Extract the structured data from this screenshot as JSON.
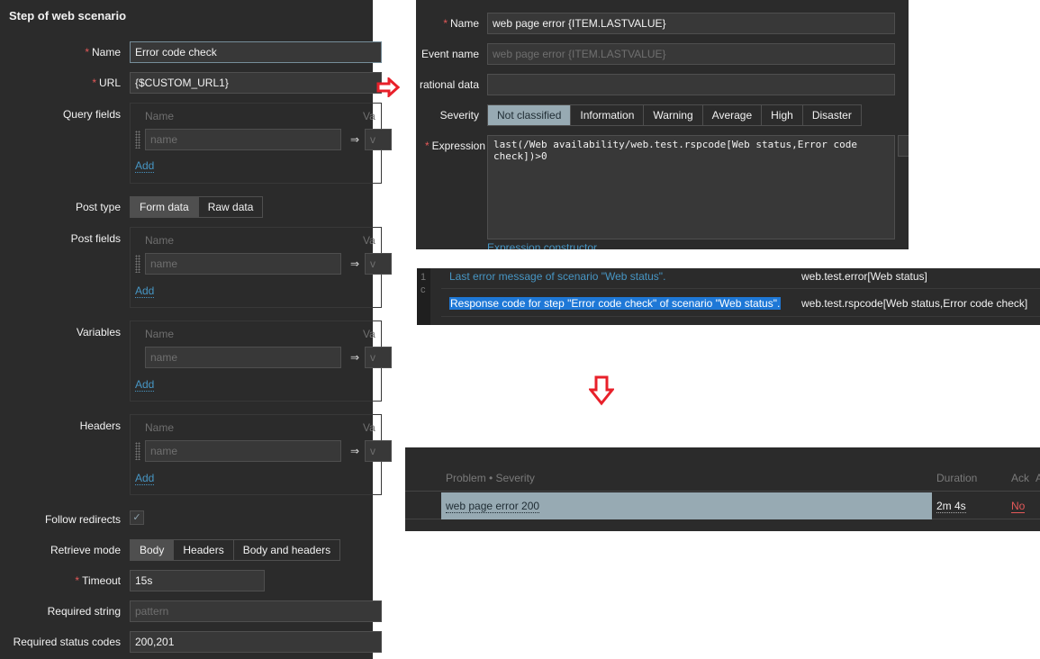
{
  "step_form": {
    "title": "Step of web scenario",
    "name_label": "Name",
    "name_value": "Error code check",
    "url_label": "URL",
    "url_value": "{$CUSTOM_URL1}",
    "query_fields_label": "Query fields",
    "post_type_label": "Post type",
    "post_type_options": [
      "Form data",
      "Raw data"
    ],
    "post_fields_label": "Post fields",
    "variables_label": "Variables",
    "headers_label": "Headers",
    "col_name": "Name",
    "col_value": "Va",
    "name_placeholder": "name",
    "value_placeholder": "v",
    "add_label": "Add",
    "arrow": "⇒",
    "follow_redirects_label": "Follow redirects",
    "follow_redirects_checked": true,
    "retrieve_mode_label": "Retrieve mode",
    "retrieve_mode_options": [
      "Body",
      "Headers",
      "Body and headers"
    ],
    "timeout_label": "Timeout",
    "timeout_value": "15s",
    "required_string_label": "Required string",
    "required_string_placeholder": "pattern",
    "required_status_codes_label": "Required status codes",
    "required_status_codes_value": "200,201"
  },
  "trigger_form": {
    "name_label": "Name",
    "name_value": "web page error {ITEM.LASTVALUE}",
    "event_name_label": "Event name",
    "event_name_placeholder": "web page error {ITEM.LASTVALUE}",
    "operational_data_label": "rational data",
    "severity_label": "Severity",
    "severities": [
      "Not classified",
      "Information",
      "Warning",
      "Average",
      "High",
      "Disaster"
    ],
    "expression_label": "Expression",
    "expression_value": "last(/Web availability/web.test.rspcode[Web status,Error code check])>0",
    "expression_constructor": "Expression constructor"
  },
  "item_list": {
    "gutter": [
      "1",
      "c"
    ],
    "rows": [
      {
        "description": "Last error message of scenario \"Web status\".",
        "key": "web.test.error[Web status]"
      },
      {
        "description": "Response code for step \"Error code check\" of scenario \"Web status\".",
        "key": "web.test.rspcode[Web status,Error code check]"
      }
    ]
  },
  "problems": {
    "col_problem": "Problem • Severity",
    "col_duration": "Duration",
    "col_ack": "Ack",
    "col_extra": "A",
    "row": {
      "problem": "web page error 200",
      "duration": "2m 4s",
      "ack": "No"
    }
  },
  "colors": {
    "arrow": "#e8202a",
    "selected_severity": "#97aab3",
    "link": "#4796c4",
    "ack_no": "#e45959"
  }
}
